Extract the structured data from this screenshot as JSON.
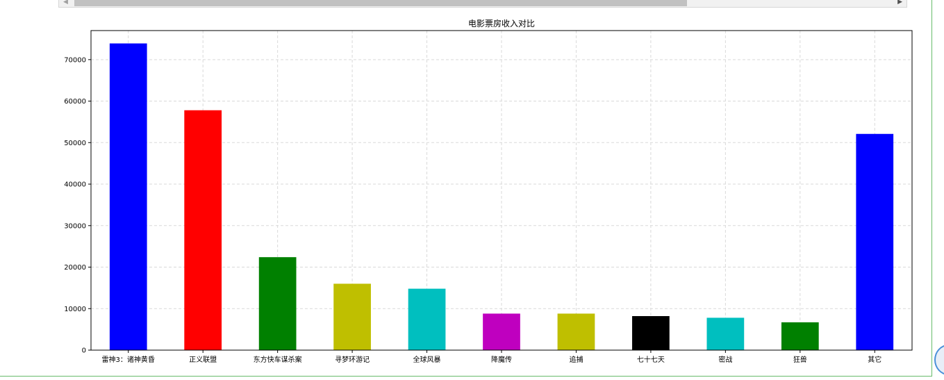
{
  "chart_data": {
    "type": "bar",
    "title": "电影票房收入对比",
    "xlabel": "",
    "ylabel": "",
    "categories": [
      "雷神3：诸神黄昏",
      "正义联盟",
      "东方快车谋杀案",
      "寻梦环游记",
      "全球风暴",
      "降魔传",
      "追捕",
      "七十七天",
      "密战",
      "狂兽",
      "其它"
    ],
    "values": [
      73900,
      57800,
      22400,
      16000,
      14800,
      8800,
      8800,
      8200,
      7800,
      6700,
      52100
    ],
    "colors": [
      "#0000ff",
      "#ff0000",
      "#008000",
      "#bfbf00",
      "#00bfbf",
      "#bf00bf",
      "#bfbf00",
      "#000000",
      "#00bfbf",
      "#008000",
      "#0000ff"
    ],
    "ylim": [
      0,
      77000
    ],
    "yticks": [
      0,
      10000,
      20000,
      30000,
      40000,
      50000,
      60000,
      70000
    ],
    "grid": true
  }
}
